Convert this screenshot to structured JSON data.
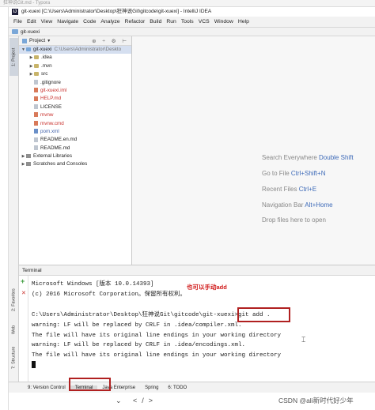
{
  "outer": {
    "strip_text": "狂神说Git.md - Typora"
  },
  "window": {
    "title": "git-xuexi [C:\\Users\\Administrator\\Desktop\\狂神说Git\\gitcode\\git-xuexi] - IntelliJ IDEA",
    "app_icon": "IJ"
  },
  "menu": [
    "File",
    "Edit",
    "View",
    "Navigate",
    "Code",
    "Analyze",
    "Refactor",
    "Build",
    "Run",
    "Tools",
    "VCS",
    "Window",
    "Help"
  ],
  "navbar": {
    "breadcrumb": "git-xuexi"
  },
  "left_strip": {
    "project_tab": "1: Project",
    "favorites_tab": "2: Favorites",
    "web_tab": "Web",
    "structure_tab": "7: Structure"
  },
  "project": {
    "header_label": "Project",
    "tools": "⊕ ÷ ⚙ ⊢",
    "tree": [
      {
        "indent": 0,
        "arrow": "▼",
        "icon": "folder-blue",
        "label": "git-xuexi",
        "path": "C:\\Users\\Administrator\\Deskto",
        "selected": true
      },
      {
        "indent": 1,
        "arrow": "▶",
        "icon": "folder",
        "label": ".idea"
      },
      {
        "indent": 1,
        "arrow": "▶",
        "icon": "folder",
        "label": ".mvn"
      },
      {
        "indent": 1,
        "arrow": "▶",
        "icon": "folder",
        "label": "src"
      },
      {
        "indent": 1,
        "arrow": "",
        "icon": "file",
        "label": ".gitignore"
      },
      {
        "indent": 1,
        "arrow": "",
        "icon": "file-red",
        "label": "git-xuexi.iml",
        "color": "red"
      },
      {
        "indent": 1,
        "arrow": "",
        "icon": "file-red",
        "label": "HELP.md",
        "color": "red"
      },
      {
        "indent": 1,
        "arrow": "",
        "icon": "file",
        "label": "LICENSE"
      },
      {
        "indent": 1,
        "arrow": "",
        "icon": "file-red",
        "label": "mvnw",
        "color": "red"
      },
      {
        "indent": 1,
        "arrow": "",
        "icon": "file-red",
        "label": "mvnw.cmd",
        "color": "red"
      },
      {
        "indent": 1,
        "arrow": "",
        "icon": "file-m",
        "label": "pom.xml",
        "color": "blue"
      },
      {
        "indent": 1,
        "arrow": "",
        "icon": "file",
        "label": "README.en.md"
      },
      {
        "indent": 1,
        "arrow": "",
        "icon": "file",
        "label": "README.md"
      },
      {
        "indent": 0,
        "arrow": "▶",
        "icon": "lib",
        "label": "External Libraries"
      },
      {
        "indent": 0,
        "arrow": "▶",
        "icon": "lib",
        "label": "Scratches and Consoles"
      }
    ]
  },
  "editor_hints": [
    {
      "text": "Search Everywhere ",
      "shortcut": "Double Shift"
    },
    {
      "text": "Go to File ",
      "shortcut": "Ctrl+Shift+N"
    },
    {
      "text": "Recent Files ",
      "shortcut": "Ctrl+E"
    },
    {
      "text": "Navigation Bar ",
      "shortcut": "Alt+Home"
    },
    {
      "text": "Drop files here to open",
      "shortcut": ""
    }
  ],
  "terminal": {
    "header": "Terminal",
    "lines": [
      "Microsoft Windows [版本 10.0.14393]",
      "(c) 2016 Microsoft Corporation。保留所有权利。",
      "",
      "C:\\Users\\Administrator\\Desktop\\狂神说Git\\gitcode\\git-xuexi>git add .",
      "warning: LF will be replaced by CRLF in .idea/compiler.xml.",
      "The file will have its original line endings in your working directory",
      "warning: LF will be replaced by CRLF in .idea/encodings.xml.",
      "The file will have its original line endings in your working directory"
    ],
    "annotation": "也可以手动add"
  },
  "bottom_tools": [
    {
      "label": "9: Version Control",
      "active": false
    },
    {
      "label": "Terminal",
      "active": true
    },
    {
      "label": "Java Enterprise",
      "active": false
    },
    {
      "label": "Spring",
      "active": false
    },
    {
      "label": "6: TODO",
      "active": false
    }
  ],
  "footer": {
    "glyphs": "⌄ </>",
    "watermark": "CSDN @ali新时代好少年"
  },
  "colors": {
    "annotation_red": "#d01818",
    "shortcut_blue": "#3d6ab8",
    "selected_row": "#d5dff0"
  }
}
